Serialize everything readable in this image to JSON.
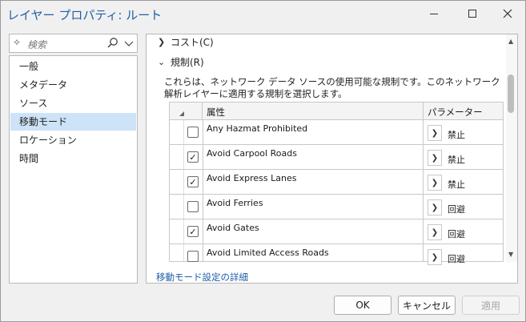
{
  "window": {
    "title": "レイヤー プロパティ: ルート"
  },
  "search": {
    "placeholder": "検索"
  },
  "nav": {
    "items": [
      {
        "label": "一般",
        "selected": false
      },
      {
        "label": "メタデータ",
        "selected": false
      },
      {
        "label": "ソース",
        "selected": false
      },
      {
        "label": "移動モード",
        "selected": true
      },
      {
        "label": "ロケーション",
        "selected": false
      },
      {
        "label": "時間",
        "selected": false
      }
    ]
  },
  "sections": {
    "cost": {
      "label": "コスト(C)",
      "expanded": false
    },
    "restrictions": {
      "label": "規制(R)",
      "expanded": true,
      "description": "これらは、ネットワーク データ ソースの使用可能な規制です。このネットワーク解析レイヤーに適用する規制を選択します。"
    }
  },
  "grid": {
    "col_attribute": "属性",
    "col_parameter": "パラメーター",
    "rows": [
      {
        "name": "Any Hazmat Prohibited",
        "checked": false,
        "value": "禁止"
      },
      {
        "name": "Avoid Carpool Roads",
        "checked": true,
        "value": "禁止"
      },
      {
        "name": "Avoid Express Lanes",
        "checked": true,
        "value": "禁止"
      },
      {
        "name": "Avoid Ferries",
        "checked": false,
        "value": "回避"
      },
      {
        "name": "Avoid Gates",
        "checked": true,
        "value": "回避"
      },
      {
        "name": "Avoid Limited Access Roads",
        "checked": false,
        "value": "回避"
      }
    ]
  },
  "link": {
    "text": "移動モード設定の詳細"
  },
  "buttons": {
    "ok": "OK",
    "cancel": "キャンセル",
    "apply": "適用"
  }
}
